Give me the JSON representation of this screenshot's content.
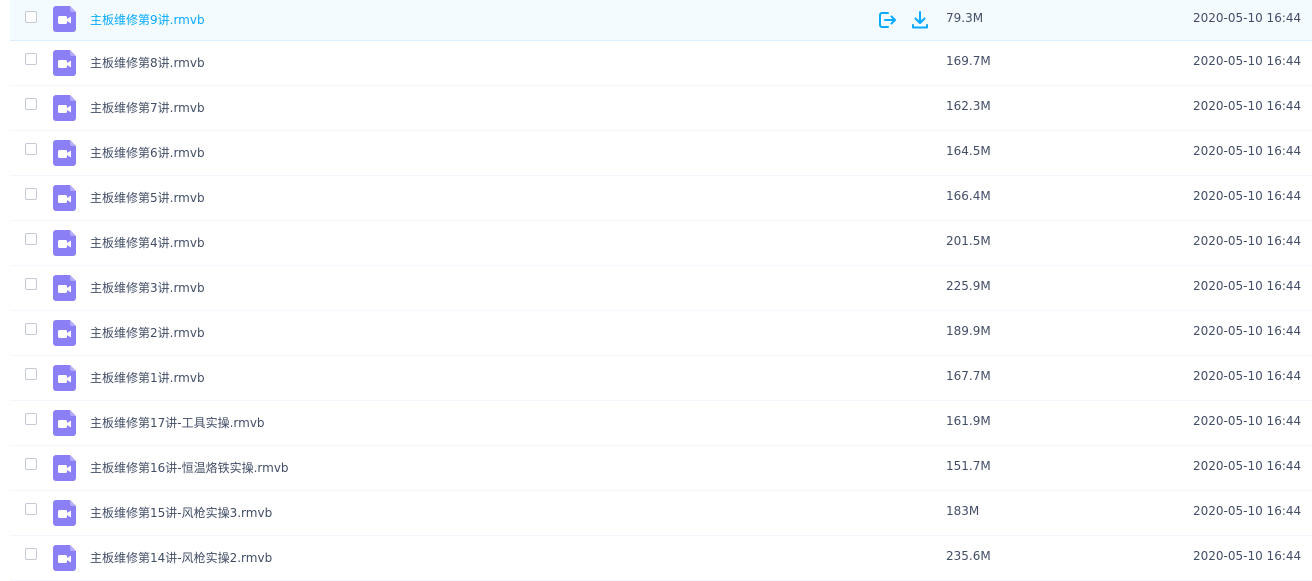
{
  "files": [
    {
      "name": "主板维修第9讲.rmvb",
      "size": "79.3M",
      "date": "2020-05-10 16:44"
    },
    {
      "name": "主板维修第8讲.rmvb",
      "size": "169.7M",
      "date": "2020-05-10 16:44"
    },
    {
      "name": "主板维修第7讲.rmvb",
      "size": "162.3M",
      "date": "2020-05-10 16:44"
    },
    {
      "name": "主板维修第6讲.rmvb",
      "size": "164.5M",
      "date": "2020-05-10 16:44"
    },
    {
      "name": "主板维修第5讲.rmvb",
      "size": "166.4M",
      "date": "2020-05-10 16:44"
    },
    {
      "name": "主板维修第4讲.rmvb",
      "size": "201.5M",
      "date": "2020-05-10 16:44"
    },
    {
      "name": "主板维修第3讲.rmvb",
      "size": "225.9M",
      "date": "2020-05-10 16:44"
    },
    {
      "name": "主板维修第2讲.rmvb",
      "size": "189.9M",
      "date": "2020-05-10 16:44"
    },
    {
      "name": "主板维修第1讲.rmvb",
      "size": "167.7M",
      "date": "2020-05-10 16:44"
    },
    {
      "name": "主板维修第17讲-工具实操.rmvb",
      "size": "161.9M",
      "date": "2020-05-10 16:44"
    },
    {
      "name": "主板维修第16讲-恒温烙铁实操.rmvb",
      "size": "151.7M",
      "date": "2020-05-10 16:44"
    },
    {
      "name": "主板维修第15讲-风枪实操3.rmvb",
      "size": "183M",
      "date": "2020-05-10 16:44"
    },
    {
      "name": "主板维修第14讲-风枪实操2.rmvb",
      "size": "235.6M",
      "date": "2020-05-10 16:44"
    }
  ],
  "icons": {
    "file": "video-file-icon",
    "share": "share-export-icon",
    "download": "download-icon"
  },
  "colors": {
    "accent": "#09aaff",
    "video_icon": "#8a7ff4",
    "hover_row": "#f4fbff"
  }
}
